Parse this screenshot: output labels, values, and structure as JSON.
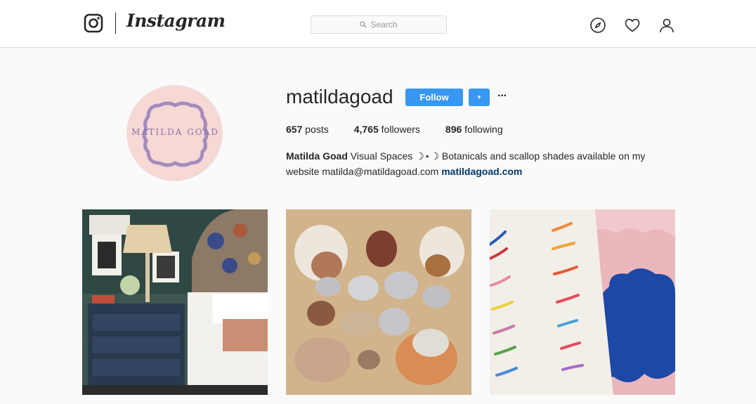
{
  "header": {
    "wordmark": "Instagram",
    "search_placeholder": "Search",
    "nav_icons": [
      "compass-icon",
      "heart-icon",
      "user-icon"
    ]
  },
  "profile": {
    "username": "matildagoad",
    "avatar_text": "MATILDA GOAD",
    "follow_label": "Follow",
    "dropdown_icon": "▾",
    "more_icon": "···",
    "stats": [
      {
        "count": "657",
        "label": "posts"
      },
      {
        "count": "4,765",
        "label": "followers"
      },
      {
        "count": "896",
        "label": "following"
      }
    ],
    "bio": {
      "name": "Matilda Goad",
      "text": "Visual Spaces ☽⋆☽ Botanicals and scallop shades available on my website matilda@matildagoad.com",
      "link": "matildagoad.com"
    }
  },
  "posts": [
    {
      "subject": "bedroom-nightstand-photo"
    },
    {
      "subject": "silver-seashells-photo"
    },
    {
      "subject": "scallop-embroidery-photo"
    }
  ],
  "colors": {
    "accent": "#3897f0",
    "link": "#003569",
    "background": "#fafafa",
    "avatar_bg": "#f6d8d4",
    "avatar_frame": "#a48bbd"
  }
}
